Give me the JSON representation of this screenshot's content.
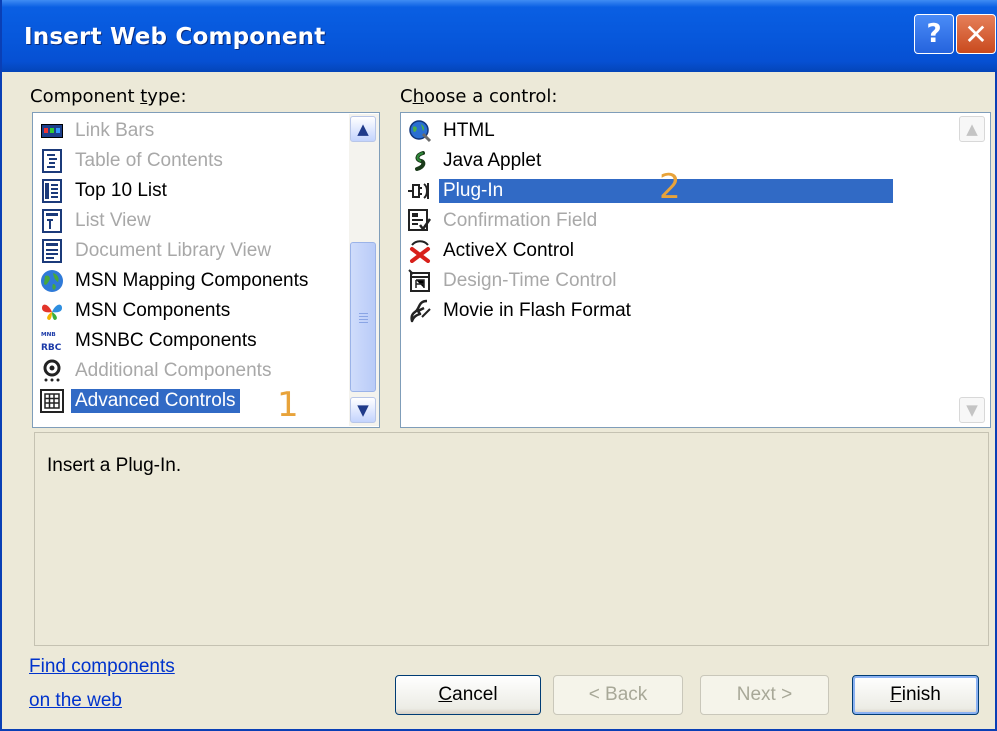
{
  "window": {
    "title": "Insert Web Component",
    "help_glyph": "?",
    "close_glyph": "✕"
  },
  "component_type": {
    "label_pre": "Component ",
    "label_key": "t",
    "label_post": "ype:",
    "items": [
      {
        "label": "Link Bars",
        "icon": "link-bars-icon",
        "disabled": true
      },
      {
        "label": "Table of Contents",
        "icon": "table-of-contents-icon",
        "disabled": true
      },
      {
        "label": "Top 10 List",
        "icon": "top-10-list-icon",
        "disabled": false
      },
      {
        "label": "List View",
        "icon": "list-view-icon",
        "disabled": true
      },
      {
        "label": "Document Library View",
        "icon": "document-library-icon",
        "disabled": true
      },
      {
        "label": "MSN Mapping Components",
        "icon": "globe-icon",
        "disabled": false
      },
      {
        "label": "MSN Components",
        "icon": "msn-butterfly-icon",
        "disabled": false
      },
      {
        "label": "MSNBC Components",
        "icon": "msnbc-icon",
        "disabled": false
      },
      {
        "label": "Additional Components",
        "icon": "additional-components-icon",
        "disabled": true
      },
      {
        "label": "Advanced Controls",
        "icon": "advanced-controls-icon",
        "disabled": false,
        "selected": true
      }
    ],
    "marker": "1"
  },
  "control": {
    "label_pre": "C",
    "label_key": "h",
    "label_post": "oose a control:",
    "items": [
      {
        "label": "HTML",
        "icon": "html-globe-icon",
        "disabled": false
      },
      {
        "label": "Java Applet",
        "icon": "java-applet-icon",
        "disabled": false
      },
      {
        "label": "Plug-In",
        "icon": "plug-in-icon",
        "disabled": false,
        "selected": true
      },
      {
        "label": "Confirmation Field",
        "icon": "confirmation-field-icon",
        "disabled": true
      },
      {
        "label": "ActiveX Control",
        "icon": "activex-icon",
        "disabled": false
      },
      {
        "label": "Design-Time Control",
        "icon": "design-time-control-icon",
        "disabled": true
      },
      {
        "label": "Movie in Flash Format",
        "icon": "flash-movie-icon",
        "disabled": false
      }
    ],
    "marker": "2"
  },
  "description": "Insert a Plug-In.",
  "find_link": {
    "line1": "Find components",
    "line2": "on the web"
  },
  "buttons": {
    "cancel_key": "C",
    "cancel_rest": "ancel",
    "back": "< Back",
    "next": "Next >",
    "finish_key": "F",
    "finish_rest": "inish"
  },
  "colors": {
    "title_bar": "#0758dc",
    "selection": "#316ac5",
    "marker": "#e8a33a",
    "link": "#0033cc",
    "dialog_face": "#ece9d8"
  }
}
